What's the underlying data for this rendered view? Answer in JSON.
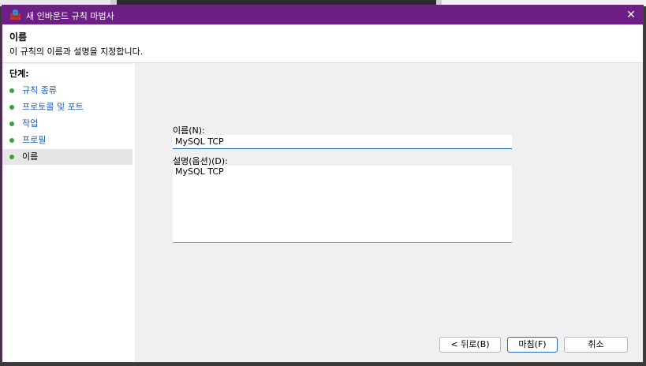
{
  "window": {
    "title": "새 인바운드 규칙 마법사",
    "close_glyph": "✕"
  },
  "header": {
    "title": "이름",
    "subtitle": "이 규칙의 이름과 설명을 지정합니다."
  },
  "steps": {
    "heading": "단계:",
    "items": [
      {
        "label": "규칙 종류"
      },
      {
        "label": "프로토콜 및 포트"
      },
      {
        "label": "작업"
      },
      {
        "label": "프로필"
      },
      {
        "label": "이름"
      }
    ],
    "active_index": 4,
    "dot_color": "#3aa13a"
  },
  "form": {
    "name_label": "이름(N):",
    "name_value": "MySQL TCP",
    "desc_label": "설명(옵션)(D):",
    "desc_value": "MySQL TCP"
  },
  "buttons": {
    "back": "< 뒤로(B)",
    "finish": "마침(F)",
    "cancel": "취소"
  },
  "colors": {
    "titlebar": "#6e1f86",
    "link": "#1a5fb4",
    "focus_underline": "#1c6fbf"
  }
}
